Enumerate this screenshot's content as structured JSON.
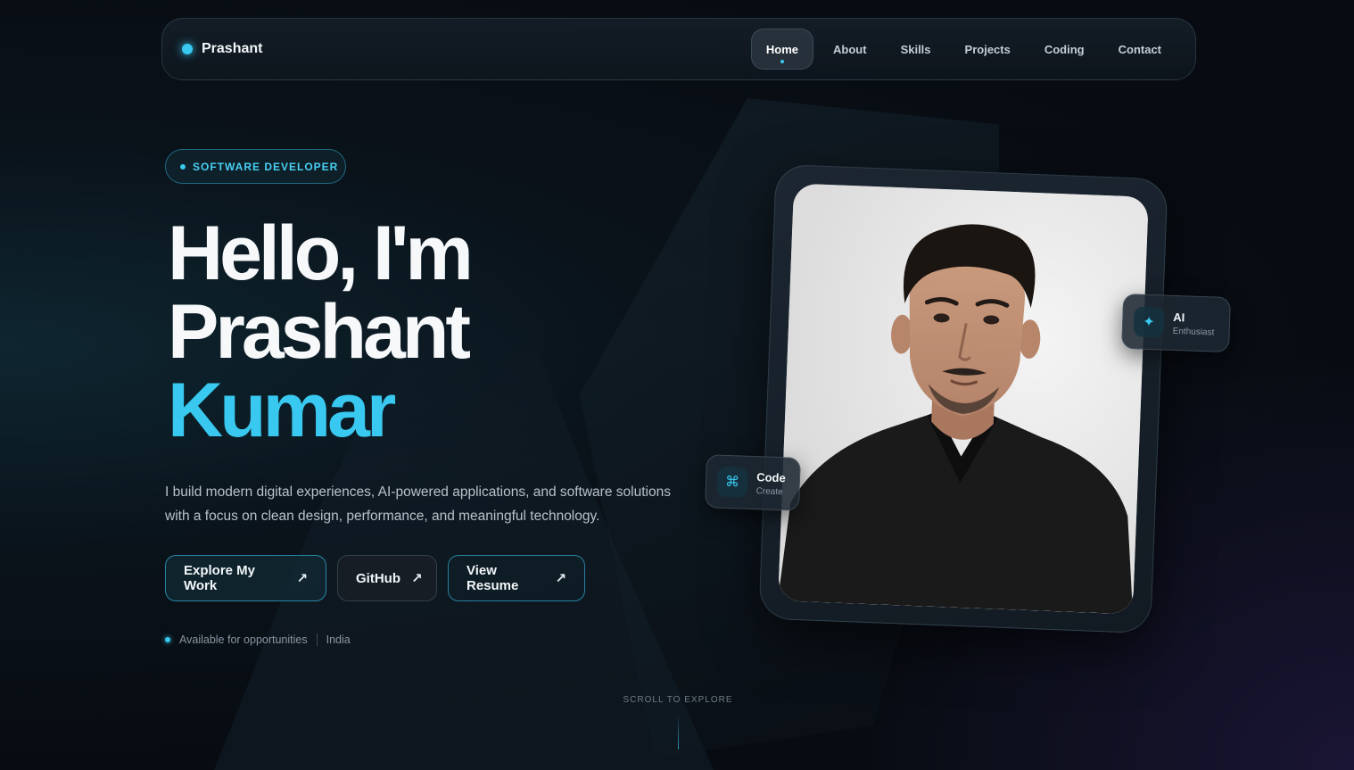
{
  "brand": {
    "name": "Prashant"
  },
  "nav": {
    "items": [
      {
        "label": "Home",
        "active": true
      },
      {
        "label": "About"
      },
      {
        "label": "Skills"
      },
      {
        "label": "Projects"
      },
      {
        "label": "Coding"
      },
      {
        "label": "Contact"
      }
    ]
  },
  "hero": {
    "badge": "SOFTWARE DEVELOPER",
    "headline_line1": "Hello, I'm",
    "headline_line2": "Prashant",
    "headline_accent": "Kumar",
    "tagline_line1": "I build modern digital experiences, AI-powered applications, and software solutions",
    "tagline_line2": "with a focus on clean design, performance, and meaningful technology.",
    "buttons": {
      "explore": "Explore My Work",
      "github": "GitHub",
      "resume": "View Resume"
    },
    "status": "Available for opportunities",
    "location": "India",
    "scroll_hint": "SCROLL TO EXPLORE"
  },
  "photo_card": {
    "ai_badge": {
      "title": "AI",
      "subtitle": "Enthusiast"
    },
    "code_badge": {
      "title": "Code",
      "subtitle": "Create"
    }
  },
  "colors": {
    "accent": "#38c8f0",
    "background": "#080c12"
  }
}
